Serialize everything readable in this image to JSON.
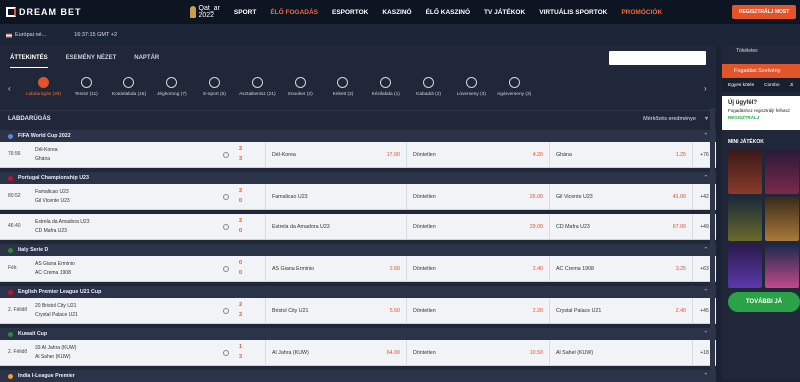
{
  "brand": {
    "name": "DREAM BET",
    "qatar": "Qat_ar",
    "year": "2022"
  },
  "nav": [
    "SPORT",
    "ÉLŐ FOGADÁS",
    "ESPORTOK",
    "KASZINÓ",
    "ÉLŐ KASZINÓ",
    "TV JÁTÉKOK",
    "VIRTUÁLIS SPORTOK",
    "PROMÓCIÓK"
  ],
  "register_label": "REGISZTRÁLJ MOST",
  "subbar": {
    "lang": "Európai né...",
    "clock": "16:37:15 GMT +2"
  },
  "tabs": [
    "ÁTTEKINTÉS",
    "ESEMÉNY NÉZET",
    "NAPTÁR"
  ],
  "sports": [
    "Labdarúgás (39)",
    "Tenisz (11)",
    "Kosárlabda (15)",
    "Jégkorong (7)",
    "E-sport (5)",
    "Asztalitenisz (21)",
    "Snooker (2)",
    "Krikett (2)",
    "Kézilabda (1)",
    "Kabaddi (2)",
    "Lóverseny (3)",
    "Agárverseny (3)"
  ],
  "section": {
    "title": "LABDARÚGÁS",
    "results": "Mérkőzés eredménye"
  },
  "leagues": [
    {
      "name": "FIFA World Cup 2022",
      "events": [
        {
          "time": "76:56",
          "t1": "Dél-Korea",
          "t2": "Ghána",
          "s1": "2",
          "s2": "3",
          "o1n": "Dél-Korea",
          "o1": "17.00",
          "oxn": "Döntetlen",
          "ox": "4.20",
          "o2n": "Ghána",
          "o2": "1.25",
          "more": "+76"
        }
      ]
    },
    {
      "name": "Portugal Championship U23",
      "events": [
        {
          "time": "80:52",
          "t1": "Famalicao U23",
          "t2": "Gil Vicente U23",
          "s1": "2",
          "s2": "0",
          "o1n": "Famalicao U23",
          "o1": "",
          "oxn": "Döntetlen",
          "ox": "26.00",
          "o2n": "Gil Vicente U23",
          "o2": "41.00",
          "more": "+42"
        },
        {
          "time": "46:40",
          "t1": "Estrela da Amadora U23",
          "t2": "CD Mafra U23",
          "s1": "2",
          "s2": "0",
          "o1n": "Estrela da Amadora U23",
          "o1": "",
          "oxn": "Döntetlen",
          "ox": "29.00",
          "o2n": "CD Mafra U23",
          "o2": "67.00",
          "more": "+49"
        }
      ]
    },
    {
      "name": "Italy Serie D",
      "events": [
        {
          "time": "Félr.",
          "t1": "AS Giana Erminio",
          "t2": "AC Crema 1908",
          "s1": "0",
          "s2": "0",
          "o1n": "AS Giana Erminio",
          "o1": "2.60",
          "oxn": "Döntetlen",
          "ox": "2.40",
          "o2n": "AC Crema 1908",
          "o2": "3.25",
          "more": "+63"
        }
      ]
    },
    {
      "name": "English Premier League U21 Cup",
      "events": [
        {
          "time": "2. Félidő",
          "t1": "20 Bristol City U21",
          "t2": "Crystal Palace U21",
          "s1": "2",
          "s2": "2",
          "o1n": "Bristol City U21",
          "o1": "5.50",
          "oxn": "Döntetlen",
          "ox": "2.20",
          "o2n": "Crystal Palace U21",
          "o2": "2.40",
          "more": "+45"
        }
      ]
    },
    {
      "name": "Kuwait Cup",
      "events": [
        {
          "time": "2. Félidő",
          "t1": "33 Al Jahra (KUW)",
          "t2": "Al Saher (KUW)",
          "s1": "1",
          "s2": "3",
          "o1n": "Al Jahra (KUW)",
          "o1": "64.00",
          "oxn": "Döntetlen",
          "ox": "10.50",
          "o2n": "Al Sahel (KUW)",
          "o2": "",
          "more": "+18"
        }
      ]
    },
    {
      "name": "India I-League Premier",
      "events": []
    }
  ],
  "right": {
    "top": "Tökéletes",
    "fog": "Fogadási Szelvény",
    "fogtabs": [
      "Egyes kötés",
      "Combo",
      "Ji"
    ],
    "uj_title": "Új ügyfél?",
    "uj_text": "Fogadáshoz regisztrálj! felhasz",
    "uj_link": "REGISZTRÁLJ",
    "mini": "MINI JÁTÉKOK",
    "tovabb": "TOVÁBBI JÁ"
  }
}
